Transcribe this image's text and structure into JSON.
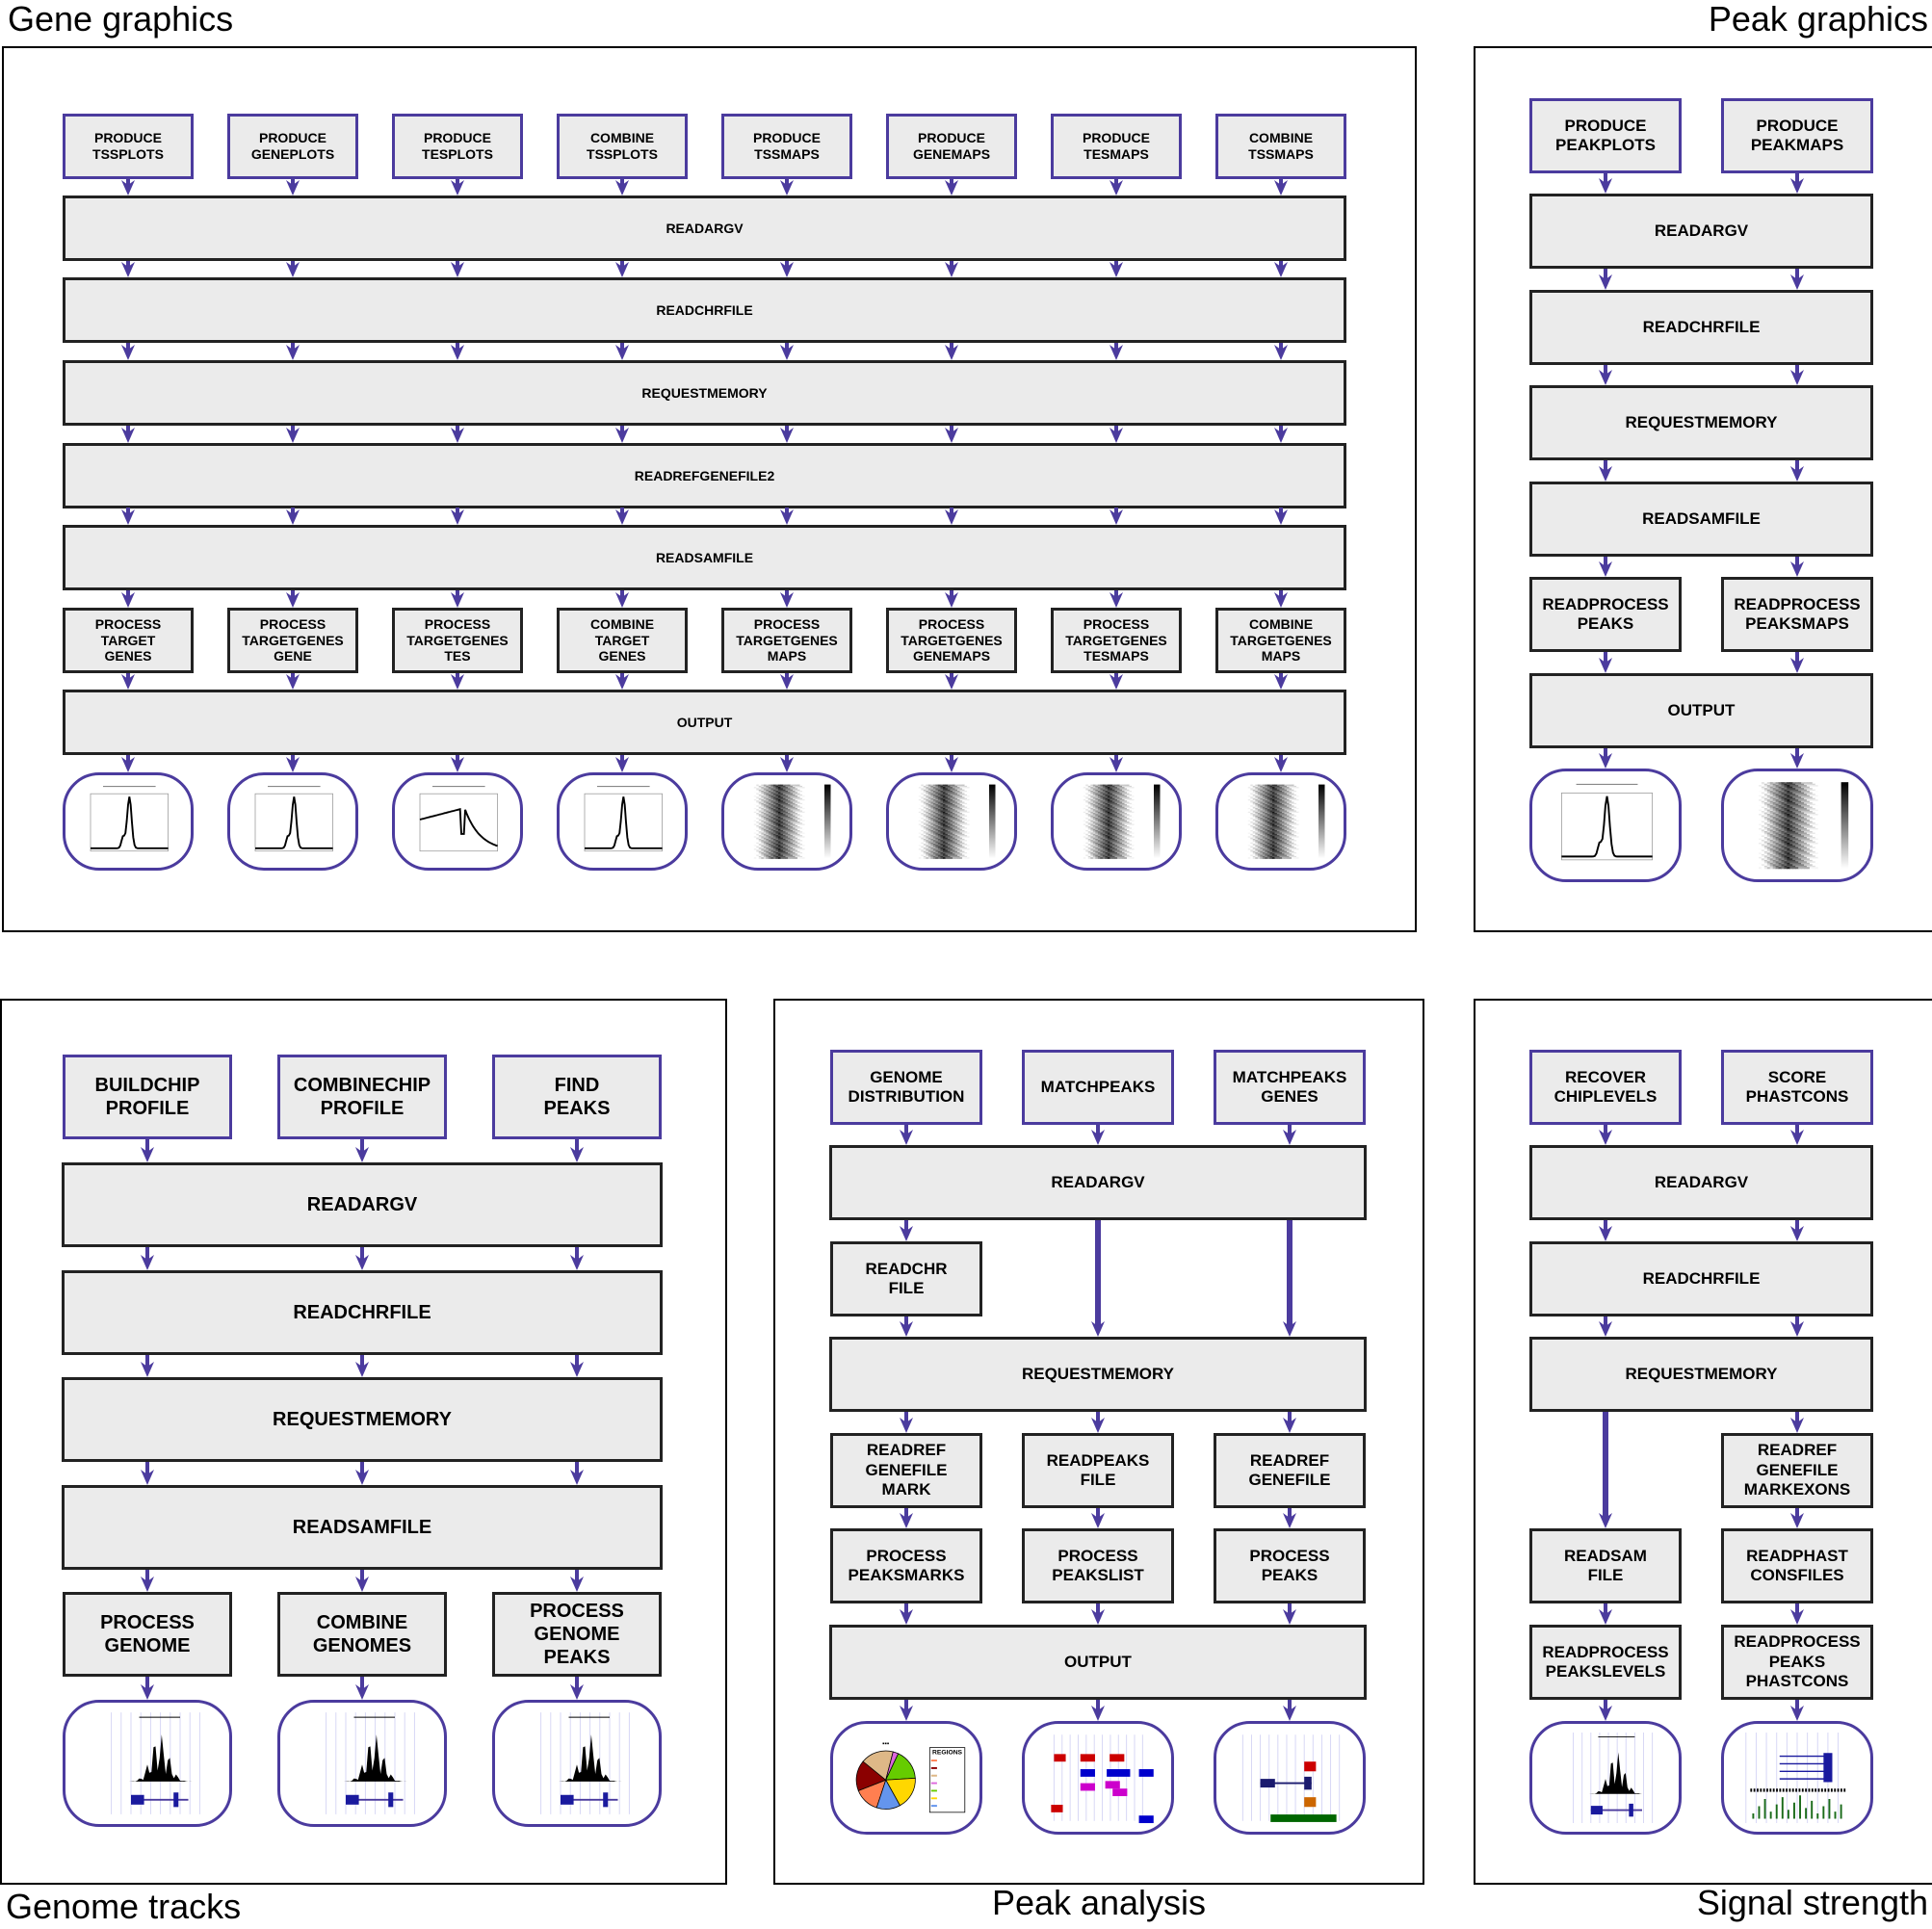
{
  "figure": {
    "accent_color": "#4b3b9e",
    "box_fill": "#ebebeb",
    "box_border": "#222222"
  },
  "panels": [
    {
      "id": "gene-graphics",
      "title": "Gene graphics",
      "title_align": "left-top",
      "entry_modules": [
        "PRODUCE\nTSSPLOTS",
        "PRODUCE\nGENEPLOTS",
        "PRODUCE\nTESPLOTS",
        "COMBINE\nTSSPLOTS",
        "PRODUCE\nTSSMAPS",
        "PRODUCE\nGENEMAPS",
        "PRODUCE\nTESMAPS",
        "COMBINE\nTSSMAPS"
      ],
      "shared_steps": [
        "READARGV",
        "READCHRFILE",
        "REQUESTMEMORY",
        "READREFGENEFILE2",
        "READSAMFILE"
      ],
      "process_modules": [
        "PROCESS\nTARGET\nGENES",
        "PROCESS\nTARGETGENES\nGENE",
        "PROCESS\nTARGETGENES\nTES",
        "COMBINE\nTARGET\nGENES",
        "PROCESS\nTARGETGENES\nMAPS",
        "PROCESS\nTARGETGENES\nGENEMAPS",
        "PROCESS\nTARGETGENES\nTESMAPS",
        "COMBINE\nTARGETGENES\nMAPS"
      ],
      "output_step": "OUTPUT",
      "thumbnails": [
        "profile-plot",
        "profile-plot",
        "profile-plot-broad",
        "profile-plot",
        "heatmap",
        "heatmap",
        "heatmap",
        "heatmap"
      ]
    },
    {
      "id": "peak-graphics",
      "title": "Peak graphics",
      "title_align": "right-top",
      "entry_modules": [
        "PRODUCE\nPEAKPLOTS",
        "PRODUCE\nPEAKMAPS"
      ],
      "shared_steps": [
        "READARGV",
        "READCHRFILE",
        "REQUESTMEMORY",
        "READSAMFILE"
      ],
      "process_modules": [
        "READPROCESS\nPEAKS",
        "READPROCESS\nPEAKSMAPS"
      ],
      "output_step": "OUTPUT",
      "thumbnails": [
        "profile-plot",
        "heatmap"
      ]
    },
    {
      "id": "genome-tracks",
      "title": "Genome tracks",
      "title_align": "left-bottom",
      "entry_modules": [
        "BUILDCHIP\nPROFILE",
        "COMBINECHIP\nPROFILE",
        "FIND\nPEAKS"
      ],
      "shared_steps": [
        "READARGV",
        "READCHRFILE",
        "REQUESTMEMORY",
        "READSAMFILE"
      ],
      "process_modules": [
        "PROCESS\nGENOME",
        "COMBINE\nGENOMES",
        "PROCESS\nGENOME\nPEAKS"
      ],
      "thumbnails": [
        "genome-track",
        "genome-track",
        "genome-track"
      ]
    },
    {
      "id": "peak-analysis",
      "title": "Peak analysis",
      "title_align": "center-bottom",
      "entry_modules": [
        "GENOME\nDISTRIBUTION",
        "MATCHPEAKS",
        "MATCHPEAKS\nGENES"
      ],
      "readargv": "READARGV",
      "readchr": "READCHR\nFILE",
      "requestmemory": "REQUESTMEMORY",
      "read_modules": [
        "READREF\nGENEFILE\nMARK",
        "READPEAKS\nFILE",
        "READREF\nGENEFILE"
      ],
      "process_modules": [
        "PROCESS\nPEAKSMARKS",
        "PROCESS\nPEAKSLIST",
        "PROCESS\nPEAKS"
      ],
      "output_step": "OUTPUT",
      "thumbnails": [
        "pie-chart",
        "peak-list-track",
        "peak-gene-track"
      ],
      "pie_legend_title": "REGIONS"
    },
    {
      "id": "signal-strength",
      "title": "Signal strength",
      "title_align": "right-bottom",
      "entry_modules": [
        "RECOVER\nCHIPLEVELS",
        "SCORE\nPHASTCONS"
      ],
      "shared_steps": [
        "READARGV",
        "READCHRFILE",
        "REQUESTMEMORY"
      ],
      "right_branch": [
        "READREF\nGENEFILE\nMARKEXONS",
        "READPHAST\nCONSFILES",
        "READPROCESS\nPEAKS\nPHASTCONS"
      ],
      "left_branch": [
        "READSAM\nFILE",
        "READPROCESS\nPEAKSLEVELS"
      ],
      "thumbnails": [
        "genome-track",
        "conservation-track"
      ]
    }
  ]
}
